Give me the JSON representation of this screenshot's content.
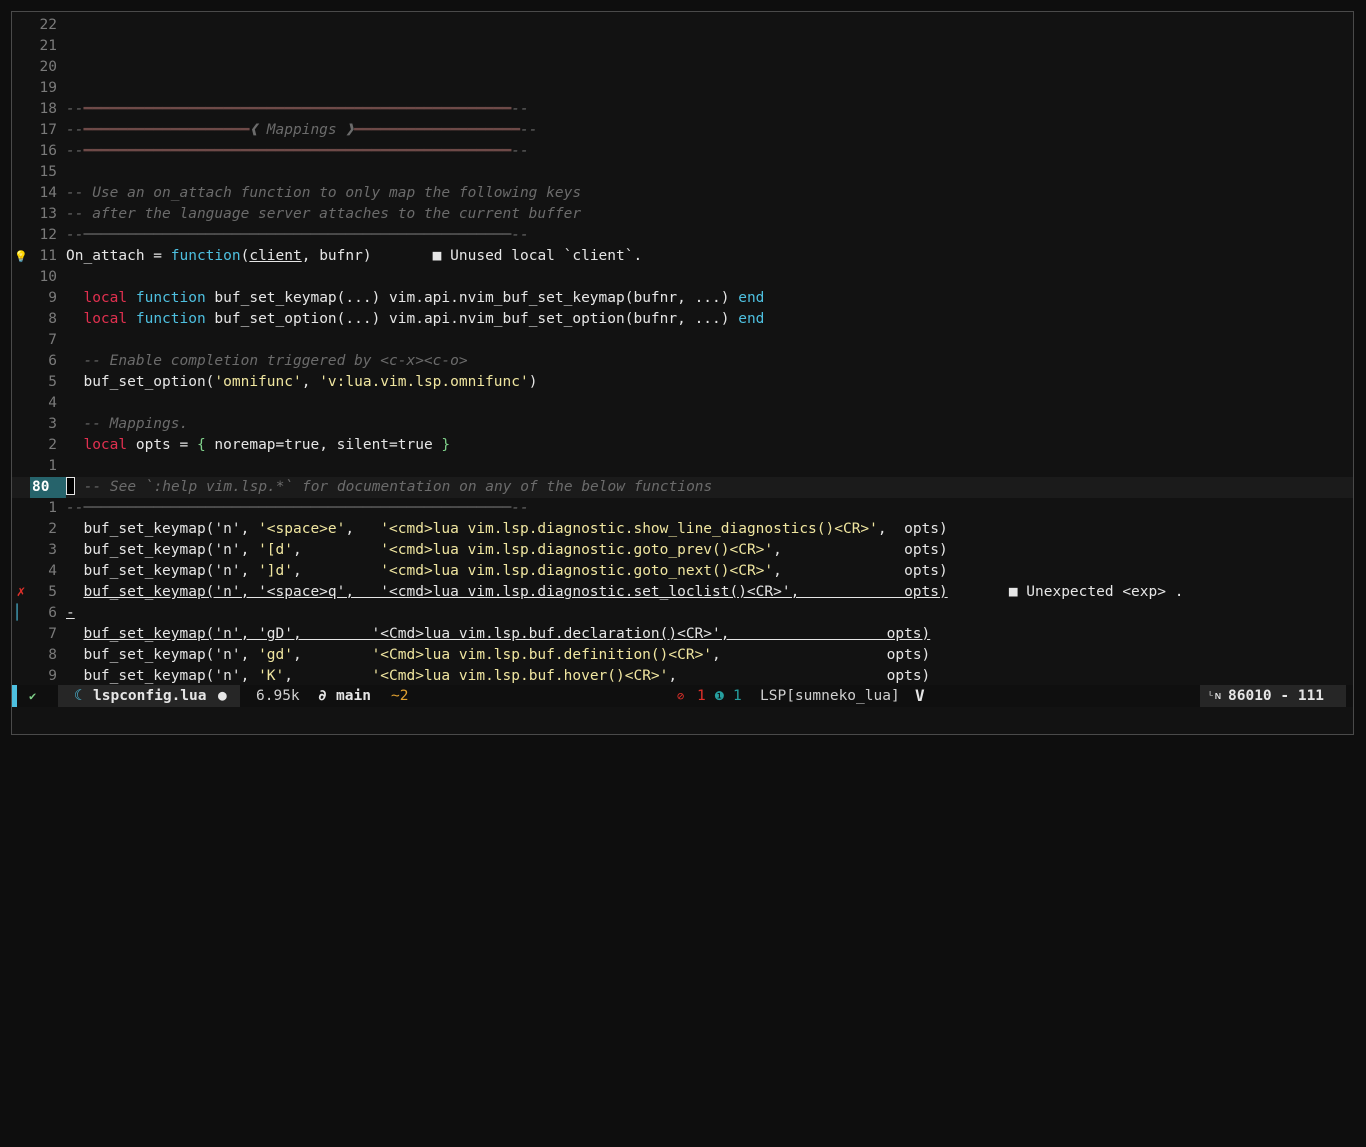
{
  "lines": [
    {
      "n": "22",
      "parts": []
    },
    {
      "n": "21",
      "parts": []
    },
    {
      "n": "20",
      "parts": []
    },
    {
      "n": "19",
      "parts": []
    },
    {
      "n": "18",
      "parts": [
        {
          "t": "--",
          "c": "cm"
        },
        {
          "t": "━━━━━━━━━━━━━━━━━━━━━━━━━━━━━━━━━━━━━━━━━━━━━━━━━",
          "c": "bar"
        },
        {
          "t": "--",
          "c": "cm"
        }
      ]
    },
    {
      "n": "17",
      "parts": [
        {
          "t": "--",
          "c": "cm"
        },
        {
          "t": "━━━━━━━━━━━━━━━━━━━",
          "c": "bar"
        },
        {
          "t": "❰ Mappings ❱",
          "c": "cm"
        },
        {
          "t": "━━━━━━━━━━━━━━━━━━━",
          "c": "bar"
        },
        {
          "t": "--",
          "c": "cm"
        }
      ]
    },
    {
      "n": "16",
      "parts": [
        {
          "t": "--",
          "c": "cm"
        },
        {
          "t": "━━━━━━━━━━━━━━━━━━━━━━━━━━━━━━━━━━━━━━━━━━━━━━━━━",
          "c": "bar"
        },
        {
          "t": "--",
          "c": "cm"
        }
      ]
    },
    {
      "n": "15",
      "parts": []
    },
    {
      "n": "14",
      "parts": [
        {
          "t": "-- Use an on_attach function to only map the following keys",
          "c": "cm"
        }
      ]
    },
    {
      "n": "13",
      "parts": [
        {
          "t": "-- after the language server attaches to the current buffer",
          "c": "cm"
        }
      ]
    },
    {
      "n": "12",
      "parts": [
        {
          "t": "--─────────────────────────────────────────────────--",
          "c": "cm"
        }
      ]
    },
    {
      "n": "11",
      "sign": "💡",
      "signColor": "#4ec0e0",
      "parts": [
        {
          "t": "On_attach = ",
          "c": "pl"
        },
        {
          "t": "function",
          "c": "fn"
        },
        {
          "t": "(",
          "c": "pl"
        },
        {
          "t": "client",
          "c": "pl",
          "u": true
        },
        {
          "t": ", bufnr)",
          "c": "pl"
        },
        {
          "t": "       ■ Unused local `client`.",
          "c": "hint"
        }
      ]
    },
    {
      "n": "10",
      "parts": []
    },
    {
      "n": "9",
      "parts": [
        {
          "t": "  "
        },
        {
          "t": "local",
          "c": "kw"
        },
        {
          "t": " "
        },
        {
          "t": "function",
          "c": "fn"
        },
        {
          "t": " buf_set_keymap(...) vim.api.nvim_buf_set_keymap(bufnr, ...) ",
          "c": "pl"
        },
        {
          "t": "end",
          "c": "fn"
        }
      ]
    },
    {
      "n": "8",
      "parts": [
        {
          "t": "  "
        },
        {
          "t": "local",
          "c": "kw"
        },
        {
          "t": " "
        },
        {
          "t": "function",
          "c": "fn"
        },
        {
          "t": " buf_set_option(...) vim.api.nvim_buf_set_option(bufnr, ...) ",
          "c": "pl"
        },
        {
          "t": "end",
          "c": "fn"
        }
      ]
    },
    {
      "n": "7",
      "parts": []
    },
    {
      "n": "6",
      "parts": [
        {
          "t": "  -- Enable completion triggered by <c-x><c-o>",
          "c": "cm"
        }
      ]
    },
    {
      "n": "5",
      "parts": [
        {
          "t": "  buf_set_option(",
          "c": "pl"
        },
        {
          "t": "'omnifunc'",
          "c": "str"
        },
        {
          "t": ", ",
          "c": "pl"
        },
        {
          "t": "'v:lua.vim.lsp.omnifunc'",
          "c": "str"
        },
        {
          "t": ")",
          "c": "pl"
        }
      ]
    },
    {
      "n": "4",
      "parts": []
    },
    {
      "n": "3",
      "parts": [
        {
          "t": "  -- Mappings.",
          "c": "cm"
        }
      ]
    },
    {
      "n": "2",
      "parts": [
        {
          "t": "  "
        },
        {
          "t": "local",
          "c": "kw"
        },
        {
          "t": " opts = ",
          "c": "pl"
        },
        {
          "t": "{",
          "c": "br"
        },
        {
          "t": " noremap=true, silent=true ",
          "c": "pl"
        },
        {
          "t": "}",
          "c": "br"
        }
      ]
    },
    {
      "n": "1",
      "parts": []
    },
    {
      "n": "80",
      "current": true,
      "cursor": true,
      "parts": [
        {
          "t": " -- See `:help vim.lsp.*` for documentation on any of the below functions",
          "c": "cm"
        }
      ]
    },
    {
      "n": "1",
      "parts": [
        {
          "t": "--─────────────────────────────────────────────────--",
          "c": "cm"
        }
      ]
    },
    {
      "n": "2",
      "parts": [
        {
          "t": "  buf_set_keymap('n', ",
          "c": "pl"
        },
        {
          "t": "'<space>e'",
          "c": "str"
        },
        {
          "t": ",   ",
          "c": "pl"
        },
        {
          "t": "'<cmd>lua vim.lsp.diagnostic.show_line_diagnostics()<CR>'",
          "c": "str"
        },
        {
          "t": ",  opts)",
          "c": "pl"
        }
      ]
    },
    {
      "n": "3",
      "parts": [
        {
          "t": "  buf_set_keymap('n', ",
          "c": "pl"
        },
        {
          "t": "'[d'",
          "c": "str"
        },
        {
          "t": ",         ",
          "c": "pl"
        },
        {
          "t": "'<cmd>lua vim.lsp.diagnostic.goto_prev()<CR>'",
          "c": "str"
        },
        {
          "t": ",              opts)",
          "c": "pl"
        }
      ]
    },
    {
      "n": "4",
      "parts": [
        {
          "t": "  buf_set_keymap('n', ",
          "c": "pl"
        },
        {
          "t": "']d'",
          "c": "str"
        },
        {
          "t": ",         ",
          "c": "pl"
        },
        {
          "t": "'<cmd>lua vim.lsp.diagnostic.goto_next()<CR>'",
          "c": "str"
        },
        {
          "t": ",              opts)",
          "c": "pl"
        }
      ]
    },
    {
      "n": "5",
      "sign": "✗",
      "signColor": "#e0302a",
      "parts": [
        {
          "t": "  "
        },
        {
          "t": "buf_set_keymap('n', '<space>q',   '<cmd>lua vim.lsp.diagnostic.set_loclist()<CR>',            opts)",
          "c": "pl",
          "u": true
        },
        {
          "t": "       ■ Unexpected <exp> .",
          "c": "err"
        }
      ]
    },
    {
      "n": "6",
      "sign": "▏",
      "signColor": "#4ec0e0",
      "parts": [
        {
          "t": "-",
          "c": "pl",
          "u": true
        }
      ]
    },
    {
      "n": "7",
      "parts": [
        {
          "t": "  "
        },
        {
          "t": "buf_set_keymap('n', 'gD',        '<Cmd>lua vim.lsp.buf.declaration()<CR>',                  opts)",
          "c": "pl",
          "u": true
        }
      ]
    },
    {
      "n": "8",
      "parts": [
        {
          "t": "  buf_set_keymap('n', ",
          "c": "pl"
        },
        {
          "t": "'gd'",
          "c": "str"
        },
        {
          "t": ",        ",
          "c": "pl"
        },
        {
          "t": "'<Cmd>lua vim.lsp.buf.definition()<CR>'",
          "c": "str"
        },
        {
          "t": ",                   opts)",
          "c": "pl"
        }
      ]
    },
    {
      "n": "9",
      "parts": [
        {
          "t": "  buf_set_keymap('n', ",
          "c": "pl"
        },
        {
          "t": "'K'",
          "c": "str"
        },
        {
          "t": ",         ",
          "c": "pl"
        },
        {
          "t": "'<Cmd>lua vim.lsp.buf.hover()<CR>'",
          "c": "str"
        },
        {
          "t": ",                        opts)",
          "c": "pl"
        }
      ]
    }
  ],
  "status": {
    "check_icon": "✔",
    "file_icon": "☾",
    "filename": "lspconfig.lua",
    "modified_dot": "●",
    "size": "6.95k",
    "branch_icon": "∂",
    "branch": "main",
    "changes": "~2",
    "errors_icon": "⊘",
    "errors": "1",
    "info_icon": "❶",
    "info": "1",
    "lsp": "LSP[sumneko_lua]",
    "mode_icon": "V",
    "ln_icon": "ᴸɴ",
    "position": "86010 - 111"
  },
  "colors": {
    "accent": "#4ec0e0",
    "error": "#e0302a",
    "keyword": "#e0304f",
    "string": "#f0e6a0",
    "current_line_number_bg": "#26636b"
  }
}
